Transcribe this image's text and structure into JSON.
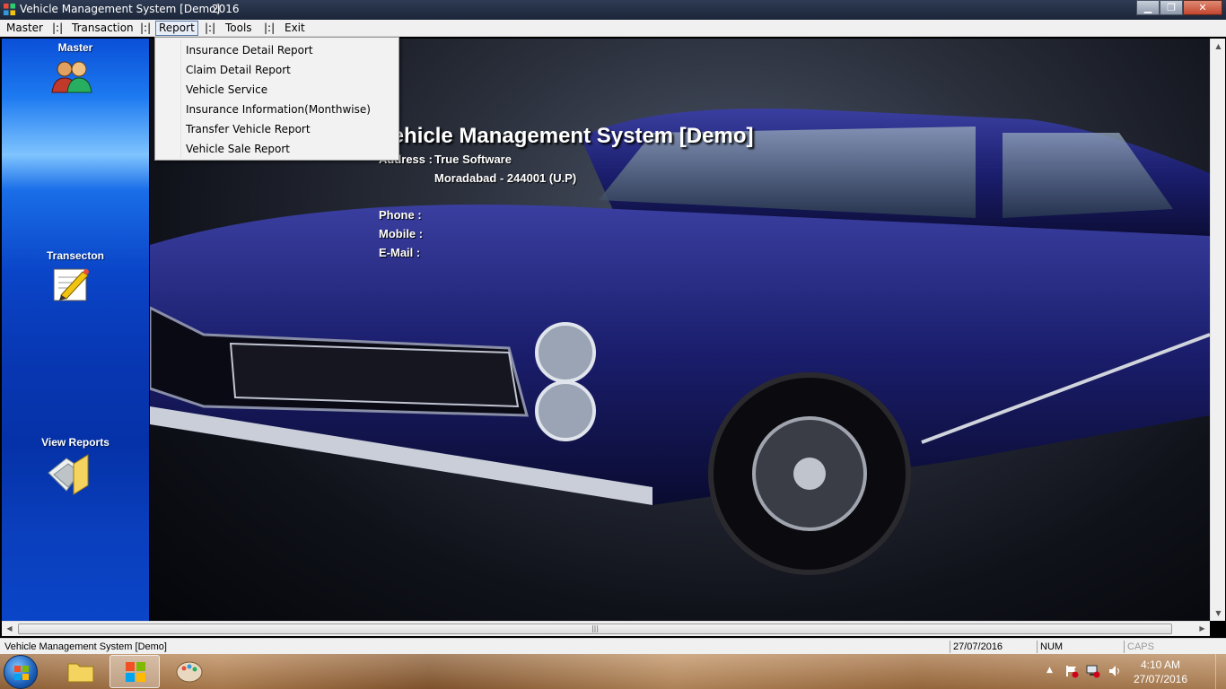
{
  "window": {
    "title": "Vehicle Management System [Demo]",
    "year": "2016",
    "buttons": {
      "minimize": "▁",
      "maximize": "❐",
      "close": "✕"
    }
  },
  "menubar": {
    "items": [
      {
        "label": "Master"
      },
      {
        "label": "|:|"
      },
      {
        "label": "Transaction"
      },
      {
        "label": "|:|"
      },
      {
        "label": "Report"
      },
      {
        "label": "|:|"
      },
      {
        "label": "Tools"
      },
      {
        "label": "|:|"
      },
      {
        "label": "Exit"
      }
    ],
    "active": "Report"
  },
  "report_menu": {
    "items": [
      {
        "label": "Insurance Detail Report"
      },
      {
        "label": "Claim Detail Report"
      },
      {
        "label": "Vehicle Service"
      },
      {
        "label": "Insurance Information(Monthwise)"
      },
      {
        "label": "Transfer Vehicle Report"
      },
      {
        "label": "Vehicle Sale Report"
      }
    ]
  },
  "sidebar": {
    "items": [
      {
        "label": "Master",
        "icon": "users-icon"
      },
      {
        "label": "Transecton",
        "icon": "edit-document-icon"
      },
      {
        "label": "View Reports",
        "icon": "reports-folder-icon"
      }
    ]
  },
  "main": {
    "title": "Vehicle Management System [Demo]",
    "address_label": "Address :",
    "address_line1": "True  Software",
    "address_line2": "Moradabad - 244001 (U.P)",
    "phone_label": "Phone    :",
    "mobile_label": "Mobile   :",
    "email_label": "E-Mail    :"
  },
  "statusbar": {
    "app": "Vehicle Management System [Demo]",
    "date": "27/07/2016",
    "num": "NUM",
    "caps": "CAPS"
  },
  "taskbar": {
    "time": "4:10 AM",
    "date": "27/07/2016"
  },
  "colors": {
    "accent": "#0a45c8",
    "car": "#1a1d6b"
  }
}
